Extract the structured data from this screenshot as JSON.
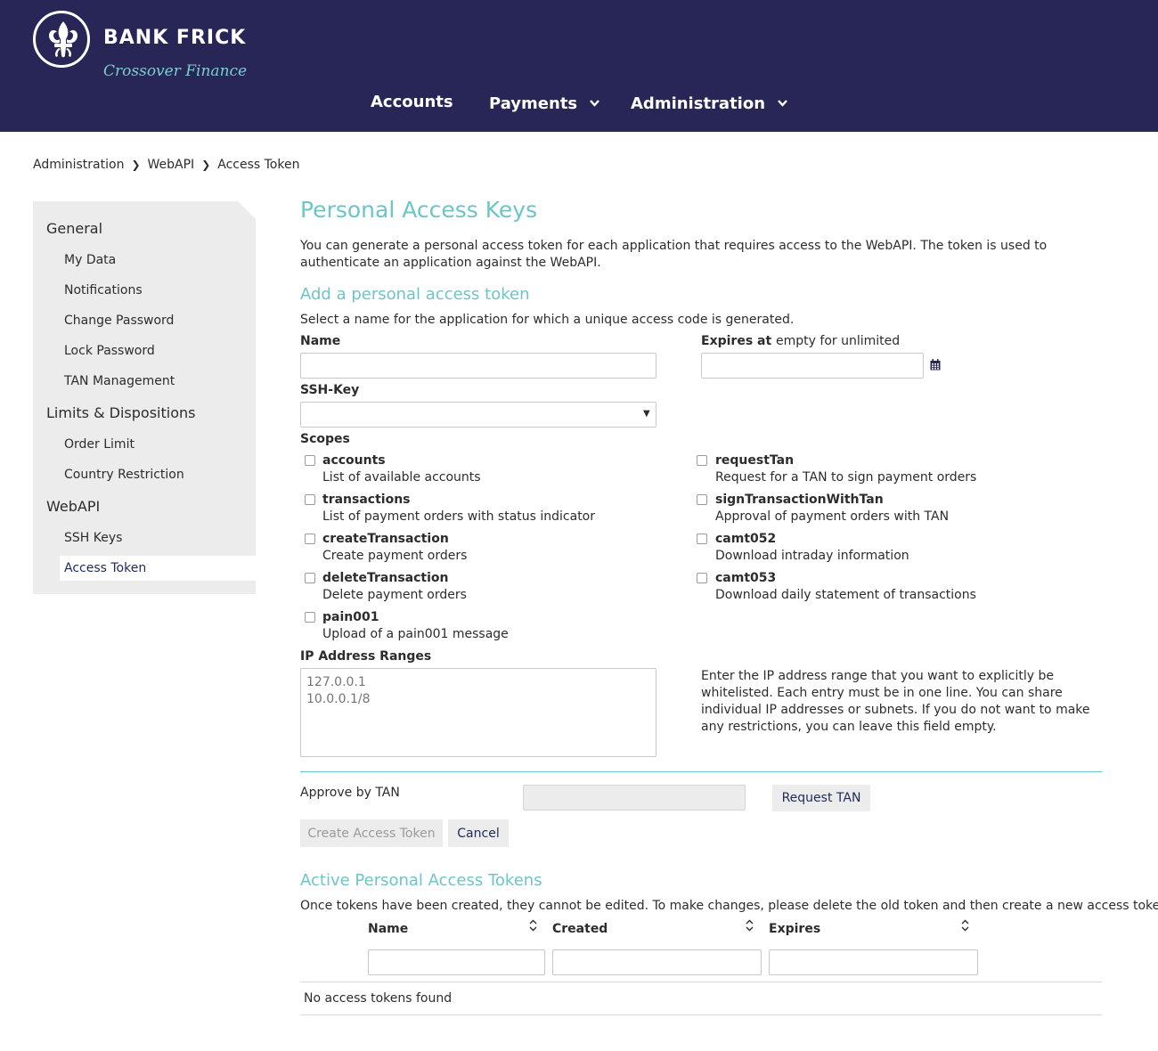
{
  "header": {
    "brand": "BANK FRICK",
    "tagline": "Crossover Finance",
    "logo_icon": "fleur-de-lis-icon",
    "nav": [
      {
        "label": "Accounts",
        "dropdown": false
      },
      {
        "label": "Payments",
        "dropdown": true
      },
      {
        "label": "Administration",
        "dropdown": true
      }
    ]
  },
  "breadcrumb": [
    "Administration",
    "WebAPI",
    "Access Token"
  ],
  "sidebar": {
    "groups": [
      {
        "label": "General",
        "items": [
          "My Data",
          "Notifications",
          "Change Password",
          "Lock Password",
          "TAN Management"
        ]
      },
      {
        "label": "Limits & Dispositions",
        "items": [
          "Order Limit",
          "Country Restriction"
        ]
      },
      {
        "label": "WebAPI",
        "items": [
          "SSH Keys",
          "Access Token"
        ]
      }
    ],
    "active_item": "Access Token"
  },
  "main": {
    "title": "Personal Access Keys",
    "intro": "You can generate a personal access token for each application that requires access to the WebAPI. The token is used to authenticate an application against the WebAPI.",
    "add_section": {
      "title": "Add a personal access token",
      "description": "Select a name for the application for which a unique access code is generated.",
      "name_label": "Name",
      "name_value": "",
      "expires_label": "Expires at",
      "expires_hint": "empty for unlimited",
      "expires_value": "",
      "ssh_key_label": "SSH-Key",
      "ssh_key_value": "",
      "scopes_label": "Scopes",
      "scopes_left": [
        {
          "name": "accounts",
          "desc": "List of available accounts",
          "checked": false
        },
        {
          "name": "transactions",
          "desc": "List of payment orders with status indicator",
          "checked": false
        },
        {
          "name": "createTransaction",
          "desc": "Create payment orders",
          "checked": false
        },
        {
          "name": "deleteTransaction",
          "desc": "Delete payment orders",
          "checked": false
        },
        {
          "name": "pain001",
          "desc": "Upload of a pain001 message",
          "checked": false
        }
      ],
      "scopes_right": [
        {
          "name": "requestTan",
          "desc": "Request for a TAN to sign payment orders",
          "checked": false
        },
        {
          "name": "signTransactionWithTan",
          "desc": "Approval of payment orders with TAN",
          "checked": false
        },
        {
          "name": "camt052",
          "desc": "Download intraday information",
          "checked": false
        },
        {
          "name": "camt053",
          "desc": "Download daily statement of transactions",
          "checked": false
        }
      ],
      "ip_label": "IP Address Ranges",
      "ip_placeholder": "127.0.0.1\n10.0.0.1/8",
      "ip_help": "Enter the IP address range that you want to explicitly be whitelisted. Each entry must be in one line. You can share individual IP addresses or subnets. If you do not want to make any restrictions, you can leave this field empty.",
      "approve_label": "Approve by TAN",
      "request_tan_button": "Request TAN",
      "create_button": "Create Access Token",
      "cancel_button": "Cancel"
    },
    "active_section": {
      "title": "Active Personal Access Tokens",
      "description": "Once tokens have been created, they cannot be edited. To make changes, please delete the old token and then create a new access token.",
      "columns": [
        "Name",
        "Created",
        "Expires"
      ],
      "empty_message": "No access tokens found"
    }
  }
}
